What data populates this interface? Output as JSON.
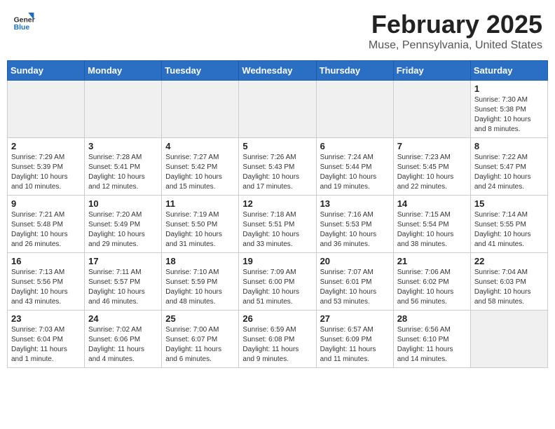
{
  "header": {
    "logo": {
      "general": "General",
      "blue": "Blue"
    },
    "title": "February 2025",
    "subtitle": "Muse, Pennsylvania, United States"
  },
  "days_of_week": [
    "Sunday",
    "Monday",
    "Tuesday",
    "Wednesday",
    "Thursday",
    "Friday",
    "Saturday"
  ],
  "weeks": [
    [
      {
        "day": "",
        "info": ""
      },
      {
        "day": "",
        "info": ""
      },
      {
        "day": "",
        "info": ""
      },
      {
        "day": "",
        "info": ""
      },
      {
        "day": "",
        "info": ""
      },
      {
        "day": "",
        "info": ""
      },
      {
        "day": "1",
        "info": "Sunrise: 7:30 AM\nSunset: 5:38 PM\nDaylight: 10 hours\nand 8 minutes."
      }
    ],
    [
      {
        "day": "2",
        "info": "Sunrise: 7:29 AM\nSunset: 5:39 PM\nDaylight: 10 hours\nand 10 minutes."
      },
      {
        "day": "3",
        "info": "Sunrise: 7:28 AM\nSunset: 5:41 PM\nDaylight: 10 hours\nand 12 minutes."
      },
      {
        "day": "4",
        "info": "Sunrise: 7:27 AM\nSunset: 5:42 PM\nDaylight: 10 hours\nand 15 minutes."
      },
      {
        "day": "5",
        "info": "Sunrise: 7:26 AM\nSunset: 5:43 PM\nDaylight: 10 hours\nand 17 minutes."
      },
      {
        "day": "6",
        "info": "Sunrise: 7:24 AM\nSunset: 5:44 PM\nDaylight: 10 hours\nand 19 minutes."
      },
      {
        "day": "7",
        "info": "Sunrise: 7:23 AM\nSunset: 5:45 PM\nDaylight: 10 hours\nand 22 minutes."
      },
      {
        "day": "8",
        "info": "Sunrise: 7:22 AM\nSunset: 5:47 PM\nDaylight: 10 hours\nand 24 minutes."
      }
    ],
    [
      {
        "day": "9",
        "info": "Sunrise: 7:21 AM\nSunset: 5:48 PM\nDaylight: 10 hours\nand 26 minutes."
      },
      {
        "day": "10",
        "info": "Sunrise: 7:20 AM\nSunset: 5:49 PM\nDaylight: 10 hours\nand 29 minutes."
      },
      {
        "day": "11",
        "info": "Sunrise: 7:19 AM\nSunset: 5:50 PM\nDaylight: 10 hours\nand 31 minutes."
      },
      {
        "day": "12",
        "info": "Sunrise: 7:18 AM\nSunset: 5:51 PM\nDaylight: 10 hours\nand 33 minutes."
      },
      {
        "day": "13",
        "info": "Sunrise: 7:16 AM\nSunset: 5:53 PM\nDaylight: 10 hours\nand 36 minutes."
      },
      {
        "day": "14",
        "info": "Sunrise: 7:15 AM\nSunset: 5:54 PM\nDaylight: 10 hours\nand 38 minutes."
      },
      {
        "day": "15",
        "info": "Sunrise: 7:14 AM\nSunset: 5:55 PM\nDaylight: 10 hours\nand 41 minutes."
      }
    ],
    [
      {
        "day": "16",
        "info": "Sunrise: 7:13 AM\nSunset: 5:56 PM\nDaylight: 10 hours\nand 43 minutes."
      },
      {
        "day": "17",
        "info": "Sunrise: 7:11 AM\nSunset: 5:57 PM\nDaylight: 10 hours\nand 46 minutes."
      },
      {
        "day": "18",
        "info": "Sunrise: 7:10 AM\nSunset: 5:59 PM\nDaylight: 10 hours\nand 48 minutes."
      },
      {
        "day": "19",
        "info": "Sunrise: 7:09 AM\nSunset: 6:00 PM\nDaylight: 10 hours\nand 51 minutes."
      },
      {
        "day": "20",
        "info": "Sunrise: 7:07 AM\nSunset: 6:01 PM\nDaylight: 10 hours\nand 53 minutes."
      },
      {
        "day": "21",
        "info": "Sunrise: 7:06 AM\nSunset: 6:02 PM\nDaylight: 10 hours\nand 56 minutes."
      },
      {
        "day": "22",
        "info": "Sunrise: 7:04 AM\nSunset: 6:03 PM\nDaylight: 10 hours\nand 58 minutes."
      }
    ],
    [
      {
        "day": "23",
        "info": "Sunrise: 7:03 AM\nSunset: 6:04 PM\nDaylight: 11 hours\nand 1 minute."
      },
      {
        "day": "24",
        "info": "Sunrise: 7:02 AM\nSunset: 6:06 PM\nDaylight: 11 hours\nand 4 minutes."
      },
      {
        "day": "25",
        "info": "Sunrise: 7:00 AM\nSunset: 6:07 PM\nDaylight: 11 hours\nand 6 minutes."
      },
      {
        "day": "26",
        "info": "Sunrise: 6:59 AM\nSunset: 6:08 PM\nDaylight: 11 hours\nand 9 minutes."
      },
      {
        "day": "27",
        "info": "Sunrise: 6:57 AM\nSunset: 6:09 PM\nDaylight: 11 hours\nand 11 minutes."
      },
      {
        "day": "28",
        "info": "Sunrise: 6:56 AM\nSunset: 6:10 PM\nDaylight: 11 hours\nand 14 minutes."
      },
      {
        "day": "",
        "info": ""
      }
    ]
  ]
}
